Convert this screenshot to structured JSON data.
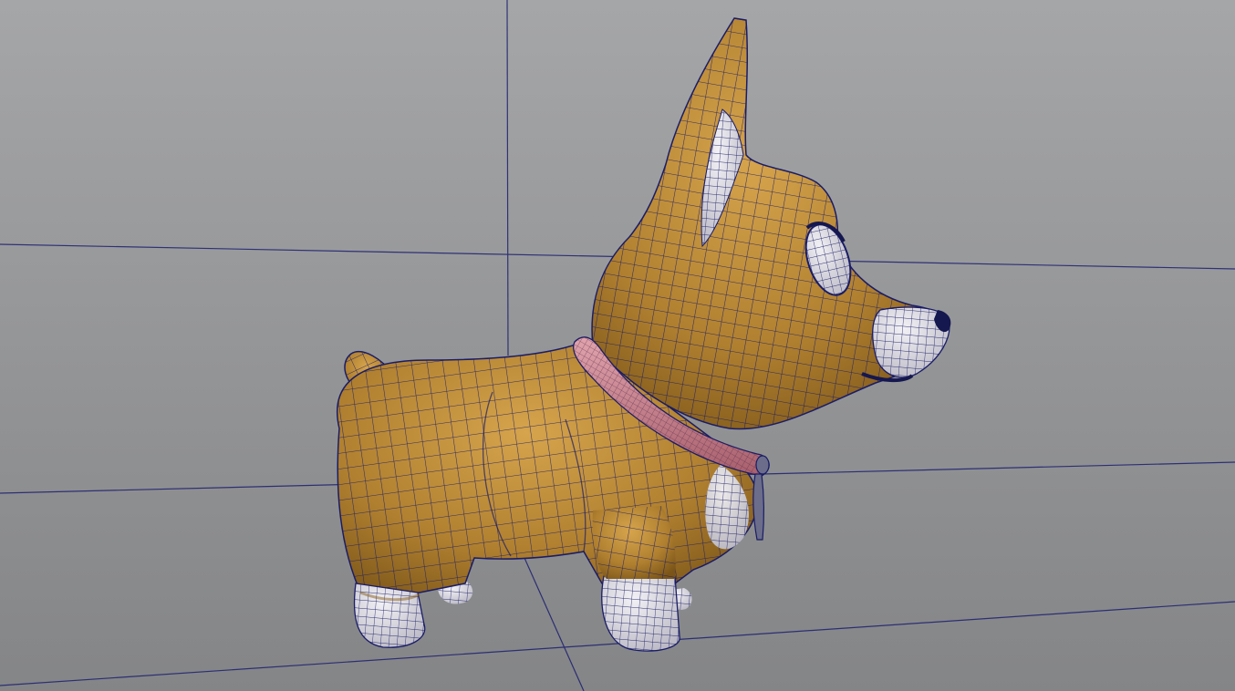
{
  "viewport": {
    "mode": "wireframe-on-shaded",
    "background_top": "#a5a6a8",
    "background_bottom": "#848587",
    "grid_color": "#1c1f6e",
    "wire_color": "#1a1c66"
  },
  "model": {
    "type": "cartoon-corgi-dog",
    "body_color": "#b08030",
    "body_highlight": "#d29f47",
    "body_shadow": "#7d5618",
    "white_color": "#dedde4",
    "collar_color": "#c9828e",
    "tag_color": "#6b6d8a"
  }
}
